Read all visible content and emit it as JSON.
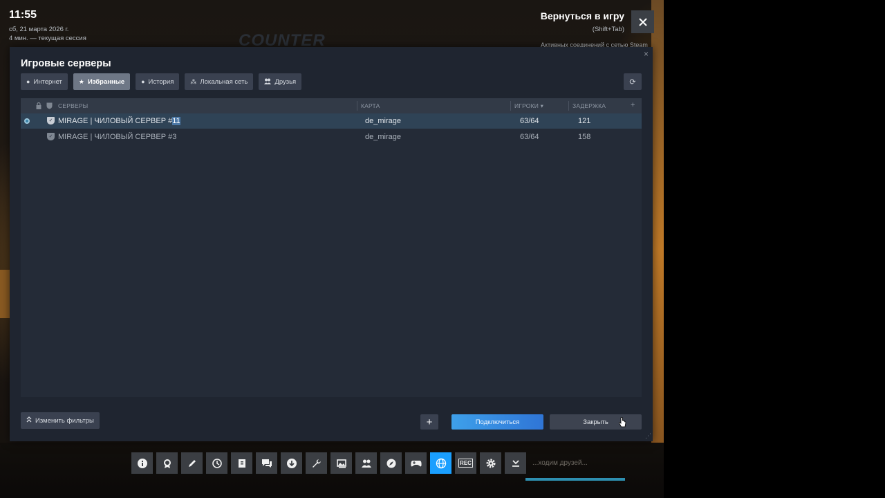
{
  "overlay": {
    "time": "11:55",
    "date": "сб, 21 марта 2026 г.",
    "session": "4 мин. — текущая сессия",
    "return_title": "Вернуться в игру",
    "return_hint": "(Shift+Tab)",
    "active_connections": "Активных соединений с сетью Steam",
    "game_logo": "COUNTER",
    "friends_text": "...ходим друзей..."
  },
  "dialog": {
    "title": "Игровые серверы",
    "close_glyph": "×",
    "tabs": [
      {
        "label": "Интернет",
        "icon": "globe-icon",
        "glyph": "●",
        "active": false
      },
      {
        "label": "Избранные",
        "icon": "star-icon",
        "glyph": "★",
        "active": true
      },
      {
        "label": "История",
        "icon": "clock-icon",
        "glyph": "●",
        "active": false
      },
      {
        "label": "Локальная сеть",
        "icon": "network-icon",
        "glyph": "⁂",
        "active": false
      },
      {
        "label": "Друзья",
        "icon": "friends-icon",
        "glyph": "👥",
        "active": false
      }
    ],
    "refresh_glyph": "⟳",
    "columns": {
      "servers": "СЕРВЕРЫ",
      "map": "КАРТА",
      "players": "ИГРОКИ ▾",
      "latency": "ЗАДЕРЖКА",
      "add": "+"
    },
    "rows": [
      {
        "name_prefix": "MIRAGE | ЧИЛОВЫЙ СЕРВЕР #",
        "name_highlight": "11",
        "map": "de_mirage",
        "players": "63/64",
        "latency": "121",
        "selected": true
      },
      {
        "name_prefix": "MIRAGE | ЧИЛОВЫЙ СЕРВЕР #3",
        "name_highlight": "",
        "map": "de_mirage",
        "players": "63/64",
        "latency": "158",
        "selected": false
      }
    ],
    "filters_label": "Изменить фильтры",
    "add_glyph": "+",
    "connect_label": "Подключиться",
    "close_label": "Закрыть"
  },
  "taskbar": [
    {
      "icon": "info-icon",
      "glyph": "i"
    },
    {
      "icon": "achievements-icon",
      "glyph": "✪"
    },
    {
      "icon": "pencil-icon",
      "glyph": "✎"
    },
    {
      "icon": "timer-icon",
      "glyph": "◷"
    },
    {
      "icon": "guide-icon",
      "glyph": "▤"
    },
    {
      "icon": "chat-icon",
      "glyph": "▭"
    },
    {
      "icon": "download-icon",
      "glyph": "⬇"
    },
    {
      "icon": "wrench-icon",
      "glyph": "✐"
    },
    {
      "icon": "screenshot-icon",
      "glyph": "▣"
    },
    {
      "icon": "friends-icon",
      "glyph": "⚇"
    },
    {
      "icon": "compass-icon",
      "glyph": "⊘"
    },
    {
      "icon": "controller-icon",
      "glyph": "⊕"
    },
    {
      "icon": "globe-icon",
      "glyph": "⊕",
      "active": true
    },
    {
      "icon": "rec-icon",
      "glyph": "REC"
    },
    {
      "icon": "settings-icon",
      "glyph": "⚙"
    },
    {
      "icon": "minimize-icon",
      "glyph": "⤓"
    }
  ]
}
